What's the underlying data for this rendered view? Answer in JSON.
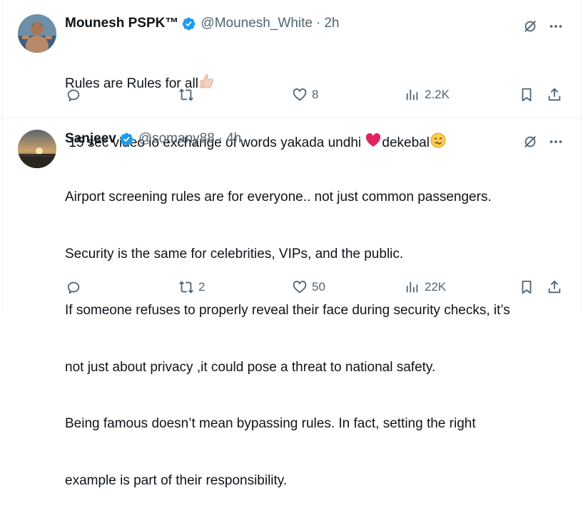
{
  "tweets": [
    {
      "name": "Mounesh PSPK™",
      "handle": "@Mounesh_White",
      "separator": "·",
      "time": "2h",
      "lines": [
        "Rules are Rules for all",
        " 15 sec video lo exchange of words yakada undhi ",
        "dekebal"
      ],
      "actions": {
        "reply": "",
        "repost": "",
        "like": "8",
        "views": "2.2K"
      }
    },
    {
      "name": "Sanjeev",
      "handle": "@somany88",
      "separator": "·",
      "time": "4h",
      "lines": [
        "Airport screening rules are for everyone.. not just common passengers.",
        "Security is the same for celebrities, VIPs, and the public.",
        "If someone refuses to properly reveal their face during security checks, it’s",
        "not just about privacy ,it could pose a threat to national safety.",
        "Being famous doesn’t mean bypassing rules. In fact, setting the right",
        "example is part of their responsibility."
      ],
      "actions": {
        "reply": "",
        "repost": "2",
        "like": "50",
        "views": "22K"
      }
    }
  ],
  "icons": {
    "verified": "verified-badge-icon",
    "grok": "grok-slash-icon",
    "more": "more-dots-icon",
    "reply": "reply-icon",
    "repost": "repost-icon",
    "like": "heart-icon",
    "views": "views-icon",
    "bookmark": "bookmark-icon",
    "share": "share-icon"
  },
  "colors": {
    "verified": "#1d9bf0",
    "text": "#0f1419",
    "muted": "#536471",
    "heart_emoji": "#e0245e"
  }
}
